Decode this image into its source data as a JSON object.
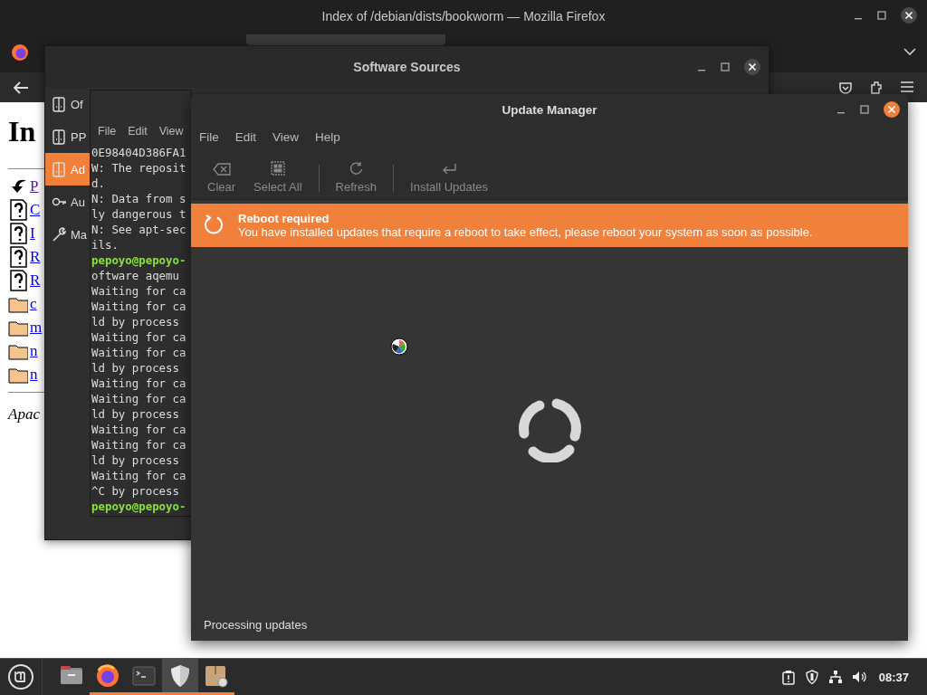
{
  "firefox": {
    "title": "Index of /debian/dists/bookworm — Mozilla Firefox",
    "page": {
      "heading": "In",
      "links": [
        {
          "kind": "back",
          "text": "P"
        },
        {
          "kind": "unknown",
          "text": "C"
        },
        {
          "kind": "unknown",
          "text": "I"
        },
        {
          "kind": "unknown",
          "text": "R"
        },
        {
          "kind": "unknown",
          "text": "R"
        },
        {
          "kind": "folder",
          "text": "c"
        },
        {
          "kind": "folder",
          "text": "m"
        },
        {
          "kind": "folder",
          "text": "n"
        },
        {
          "kind": "folder",
          "text": "n"
        }
      ],
      "footer": "Apac"
    }
  },
  "software_sources": {
    "title": "Software Sources",
    "sidebar": [
      {
        "label": "Of",
        "kind": "disc",
        "selected": false
      },
      {
        "label": "PP",
        "kind": "disc",
        "selected": false
      },
      {
        "label": "Ad",
        "kind": "disc",
        "selected": true
      },
      {
        "label": "Au",
        "kind": "key",
        "selected": false
      },
      {
        "label": "Ma",
        "kind": "wrench",
        "selected": false
      }
    ]
  },
  "terminal": {
    "menu": [
      "File",
      "Edit",
      "View"
    ],
    "lines": [
      {
        "kind": "output",
        "text": "0E98404D386FA1"
      },
      {
        "kind": "output",
        "text": "W: The reposit"
      },
      {
        "kind": "output",
        "text": "d."
      },
      {
        "kind": "output",
        "text": "N: Data from s"
      },
      {
        "kind": "output",
        "text": "ly dangerous t"
      },
      {
        "kind": "output",
        "text": "N: See apt-sec"
      },
      {
        "kind": "output",
        "text": "ils."
      },
      {
        "kind": "prompt",
        "text": "pepoyo@pepoyo-"
      },
      {
        "kind": "output",
        "text": "oftware aqemu"
      },
      {
        "kind": "output",
        "text": "Waiting for ca"
      },
      {
        "kind": "output",
        "text": "Waiting for ca"
      },
      {
        "kind": "output",
        "text": "ld by process"
      },
      {
        "kind": "output",
        "text": "Waiting for ca"
      },
      {
        "kind": "output",
        "text": "Waiting for ca"
      },
      {
        "kind": "output",
        "text": "ld by process"
      },
      {
        "kind": "output",
        "text": "Waiting for ca"
      },
      {
        "kind": "output",
        "text": "Waiting for ca"
      },
      {
        "kind": "output",
        "text": "ld by process"
      },
      {
        "kind": "output",
        "text": "Waiting for ca"
      },
      {
        "kind": "output",
        "text": "Waiting for ca"
      },
      {
        "kind": "output",
        "text": "ld by process"
      },
      {
        "kind": "output",
        "text": "Waiting for ca"
      },
      {
        "kind": "output",
        "text": "^C by process"
      },
      {
        "kind": "prompt",
        "text": "pepoyo@pepoyo-"
      }
    ]
  },
  "update_manager": {
    "title": "Update Manager",
    "menu": [
      "File",
      "Edit",
      "View",
      "Help"
    ],
    "toolbar": [
      {
        "label": "Clear",
        "kind": "clear",
        "disabled": true
      },
      {
        "label": "Select All",
        "kind": "select",
        "disabled": true
      },
      {
        "label": "Refresh",
        "kind": "refresh",
        "disabled": true
      },
      {
        "label": "Install Updates",
        "kind": "install",
        "disabled": true
      }
    ],
    "banner": {
      "title": "Reboot required",
      "message": "You have installed updates that require a reboot to take effect, please reboot your system as soon as possible."
    },
    "status": "Processing updates"
  },
  "taskbar": {
    "apps": [
      {
        "kind": "files",
        "running": false,
        "selected": false
      },
      {
        "kind": "firefox",
        "running": true,
        "selected": false
      },
      {
        "kind": "terminal",
        "running": true,
        "selected": false
      },
      {
        "kind": "shield",
        "running": true,
        "selected": true
      },
      {
        "kind": "package",
        "running": true,
        "selected": false
      }
    ],
    "clock": "08:37"
  }
}
